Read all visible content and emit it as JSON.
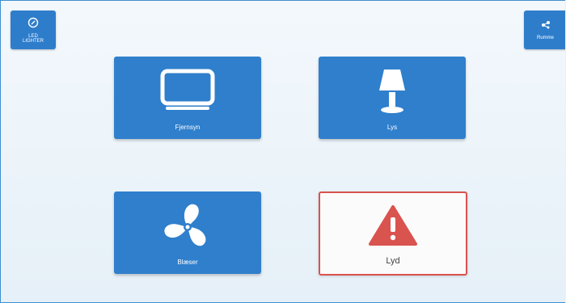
{
  "left_button": {
    "label": "LED\nLIGHTER",
    "icon": "power-icon"
  },
  "right_button": {
    "label": "Rumme",
    "icon": "rooms-icon"
  },
  "tiles": [
    {
      "label": "Fjernsyn",
      "icon": "tv-icon"
    },
    {
      "label": "Lys",
      "icon": "lamp-icon"
    },
    {
      "label": "Blæser",
      "icon": "fan-icon"
    },
    {
      "label": "Lyd",
      "icon": "alert-icon",
      "state": "alert"
    }
  ],
  "colors": {
    "tile_blue": "#2f7fcc",
    "alert_red": "#d9534f",
    "border_blue": "#3d8fd0"
  }
}
